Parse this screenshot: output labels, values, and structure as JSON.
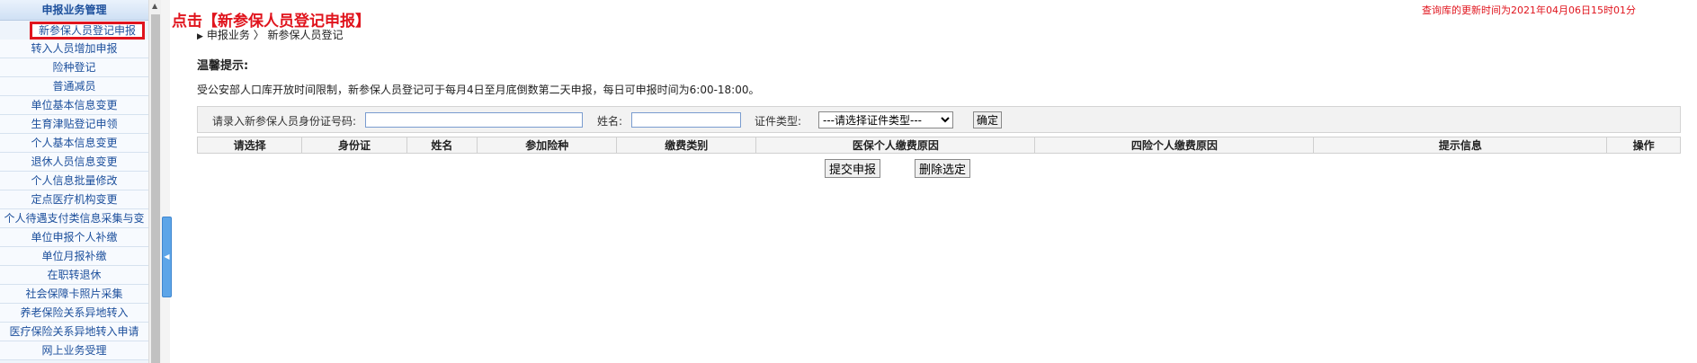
{
  "sidebar": {
    "header": "申报业务管理",
    "items": [
      {
        "label": "新参保人员登记申报",
        "active": true
      },
      {
        "label": "转入人员增加申报"
      },
      {
        "label": "险种登记"
      },
      {
        "label": "普通减员"
      },
      {
        "label": "单位基本信息变更"
      },
      {
        "label": "生育津贴登记申领"
      },
      {
        "label": "个人基本信息变更"
      },
      {
        "label": "退休人员信息变更"
      },
      {
        "label": "个人信息批量修改"
      },
      {
        "label": "定点医疗机构变更"
      },
      {
        "label": "个人待遇支付类信息采集与变"
      },
      {
        "label": "单位申报个人补缴"
      },
      {
        "label": "单位月报补缴"
      },
      {
        "label": "在职转退休"
      },
      {
        "label": "社会保障卡照片采集"
      },
      {
        "label": "养老保险关系异地转入"
      },
      {
        "label": "医疗保险关系异地转入申请"
      },
      {
        "label": "网上业务受理"
      }
    ]
  },
  "page": {
    "title": "点击【新参保人员登记申报】",
    "update_time": "查询库的更新时间为2021年04月06日15时01分",
    "breadcrumb": "申报业务 〉 新参保人员登记",
    "tips_title": "温馨提示:",
    "tips_text": "受公安部人口库开放时间限制，新参保人员登记可于每月4日至月底倒数第二天申报，每日可申报时间为6:00-18:00。"
  },
  "search": {
    "id_label": "请录入新参保人员身份证号码:",
    "id_value": "",
    "name_label": "姓名:",
    "name_value": "",
    "cert_label": "证件类型:",
    "cert_selected": "---请选择证件类型---",
    "confirm_label": "确定"
  },
  "table": {
    "columns": [
      "请选择",
      "身份证",
      "姓名",
      "参加险种",
      "缴费类别",
      "医保个人缴费原因",
      "四险个人缴费原因",
      "提示信息",
      "操作"
    ]
  },
  "actions": {
    "submit_label": "提交申报",
    "delete_label": "删除选定"
  },
  "colors": {
    "accent_red": "#e0141d",
    "nav_blue": "#1c4f9c"
  }
}
